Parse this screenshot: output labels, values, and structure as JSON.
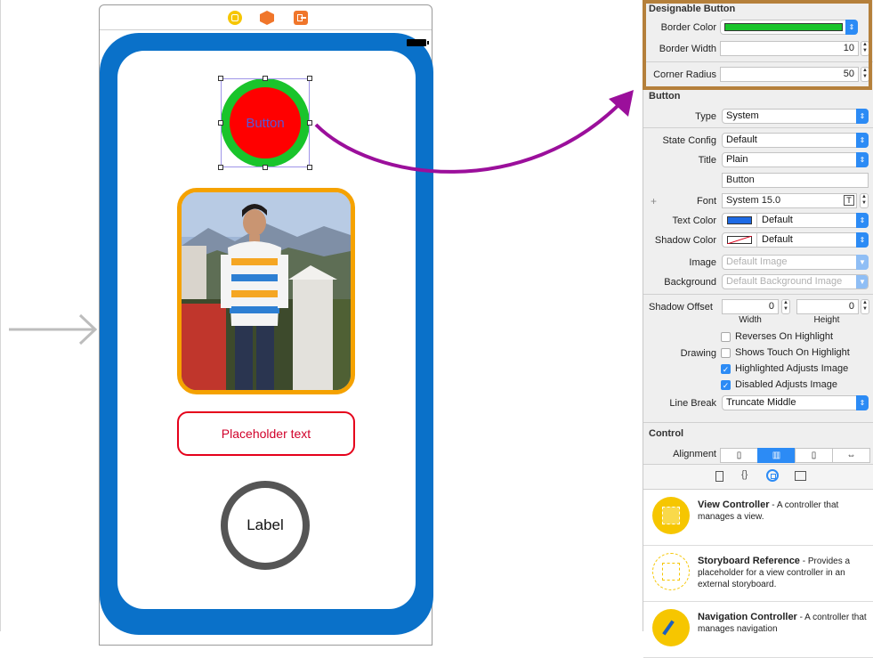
{
  "designable_button": {
    "section_title": "Designable Button",
    "border_color_label": "Border Color",
    "border_color": "#19c42b",
    "border_width_label": "Border Width",
    "border_width": "10",
    "corner_radius_label": "Corner Radius",
    "corner_radius": "50"
  },
  "button_section": {
    "title": "Button",
    "type_label": "Type",
    "type_value": "System",
    "state_config_label": "State Config",
    "state_config_value": "Default",
    "title_label": "Title",
    "title_value": "Plain",
    "title_text": "Button",
    "font_label": "Font",
    "font_value": "System 15.0",
    "text_color_label": "Text Color",
    "text_color_value": "Default",
    "text_color": "#1d6ae5",
    "shadow_color_label": "Shadow Color",
    "shadow_color_value": "Default",
    "image_label": "Image",
    "image_placeholder": "Default Image",
    "background_label": "Background",
    "background_placeholder": "Default Background Image",
    "shadow_offset_label": "Shadow Offset",
    "shadow_width": "0",
    "shadow_height": "0",
    "width_caption": "Width",
    "height_caption": "Height",
    "reverses_label": "Reverses On Highlight",
    "reverses_checked": false,
    "drawing_label": "Drawing",
    "shows_touch_label": "Shows Touch On Highlight",
    "shows_touch_checked": false,
    "highlighted_label": "Highlighted Adjusts Image",
    "highlighted_checked": true,
    "disabled_label": "Disabled Adjusts Image",
    "disabled_checked": true,
    "line_break_label": "Line Break",
    "line_break_value": "Truncate Middle"
  },
  "control_section": {
    "title": "Control",
    "alignment_label": "Alignment"
  },
  "library": {
    "items": [
      {
        "name": "View Controller",
        "description": " - A controller that manages a view."
      },
      {
        "name": "Storyboard Reference",
        "description": " - Provides a placeholder for a view controller in an external storyboard."
      },
      {
        "name": "Navigation Controller",
        "description": " - A controller that manages navigation"
      }
    ]
  },
  "canvas": {
    "button_title": "Button",
    "placeholder_text": "Placeholder text",
    "label_text": "Label",
    "device_color": "#0a71c9",
    "button_fill": "#ff0000",
    "photo_border_color": "#f5a200",
    "textfield_border_color": "#e5001b",
    "label_border_color": "#555555",
    "arrow_color": "#9b0f9b"
  }
}
